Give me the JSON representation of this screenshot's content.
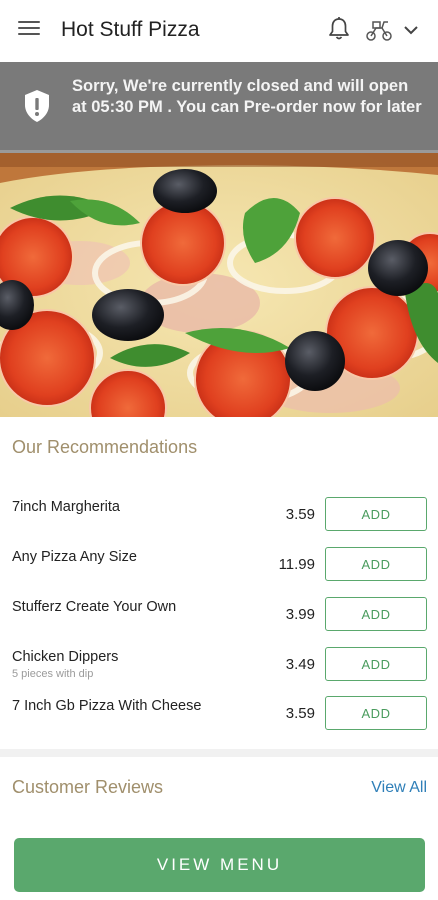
{
  "header": {
    "title": "Hot Stuff Pizza",
    "menu_icon": "hamburger-menu-icon",
    "bell_icon": "bell-icon",
    "delivery_icon": "delivery-scooter-icon",
    "dropdown_icon": "chevron-down-icon"
  },
  "banner": {
    "message": "Sorry, We're currently closed and will open at 05:30 PM . You can Pre-order now for later",
    "icon": "shield-exclamation-icon"
  },
  "recommendations": {
    "title": "Our Recommendations",
    "items": [
      {
        "name": "7inch Margherita",
        "sub": "",
        "price": "3.59",
        "button": "ADD"
      },
      {
        "name": "Any Pizza Any Size",
        "sub": "",
        "price": "11.99",
        "button": "ADD"
      },
      {
        "name": "Stufferz Create Your Own",
        "sub": "",
        "price": "3.99",
        "button": "ADD"
      },
      {
        "name": "Chicken Dippers",
        "sub": "5 pieces with dip",
        "price": "3.49",
        "button": "ADD"
      },
      {
        "name": "7 Inch Gb Pizza With Cheese",
        "sub": "",
        "price": "3.59",
        "button": "ADD"
      }
    ]
  },
  "reviews": {
    "title": "Customer Reviews",
    "view_all": "View All"
  },
  "footer": {
    "view_menu": "VIEW MENU"
  },
  "colors": {
    "accent_green": "#5aa86d",
    "banner_gray": "#7a7a7a",
    "section_title": "#a08f6c",
    "link_blue": "#2f7fb8"
  }
}
